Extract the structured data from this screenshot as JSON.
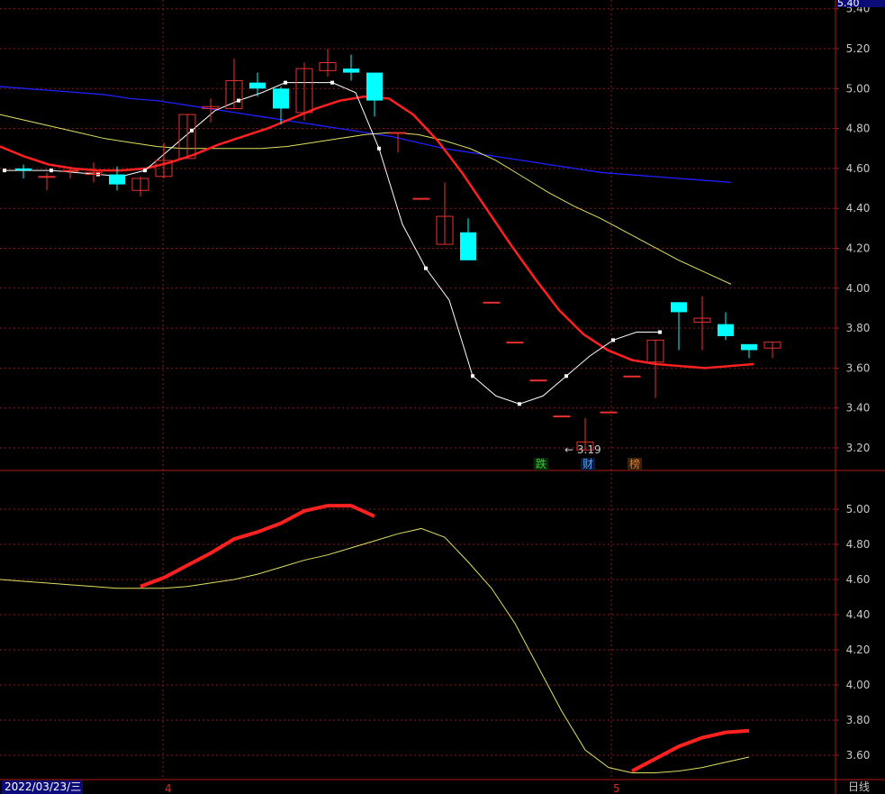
{
  "header": {
    "current_price": "5.40"
  },
  "footer": {
    "date": "2022/03/23/三",
    "period": "日线",
    "month_labels": [
      "4",
      "5"
    ]
  },
  "badges": [
    {
      "text": "跌",
      "color": "#3ec83e"
    },
    {
      "text": "财",
      "color": "#5aa0ff"
    },
    {
      "text": "榜",
      "color": "#d87a30"
    }
  ],
  "low_marker": "← 3.19",
  "colors": {
    "up": "#e83030",
    "down": "#00ffff",
    "ma_white": "#ffffff",
    "ma_red": "#ff2020",
    "ma_yellow": "#e0e060",
    "ma_blue": "#2020ff",
    "grid": "#8a1a1a",
    "border": "#b01a1a"
  },
  "chart_data": [
    {
      "type": "candlestick",
      "ylim": [
        3.05,
        5.28
      ],
      "yticks": [
        "5.40",
        "5.20",
        "5.00",
        "4.80",
        "4.60",
        "4.40",
        "4.20",
        "4.00",
        "3.80",
        "3.60",
        "3.40",
        "3.20"
      ],
      "candles": [
        {
          "o": 4.6,
          "c": 4.59,
          "h": 4.62,
          "l": 4.55
        },
        {
          "o": 4.56,
          "c": 4.56,
          "h": 4.58,
          "l": 4.49
        },
        {
          "o": 4.59,
          "c": 4.59,
          "h": 4.61,
          "l": 4.55
        },
        {
          "o": 4.57,
          "c": 4.58,
          "h": 4.63,
          "l": 4.53
        },
        {
          "o": 4.57,
          "c": 4.52,
          "h": 4.61,
          "l": 4.49
        },
        {
          "o": 4.49,
          "c": 4.55,
          "h": 4.56,
          "l": 4.46
        },
        {
          "o": 4.56,
          "c": 4.64,
          "h": 4.73,
          "l": 4.55
        },
        {
          "o": 4.65,
          "c": 4.87,
          "h": 4.87,
          "l": 4.65
        },
        {
          "o": 4.9,
          "c": 4.91,
          "h": 4.95,
          "l": 4.83
        },
        {
          "o": 4.9,
          "c": 5.04,
          "h": 5.15,
          "l": 4.9
        },
        {
          "o": 5.03,
          "c": 5.0,
          "h": 5.08,
          "l": 4.96
        },
        {
          "o": 5.0,
          "c": 4.9,
          "h": 5.01,
          "l": 4.82
        },
        {
          "o": 4.88,
          "c": 5.1,
          "h": 5.13,
          "l": 4.84
        },
        {
          "o": 5.09,
          "c": 5.13,
          "h": 5.2,
          "l": 5.06
        },
        {
          "o": 5.1,
          "c": 5.08,
          "h": 5.17,
          "l": 5.04
        },
        {
          "o": 5.08,
          "c": 4.94,
          "h": 5.08,
          "l": 4.86
        },
        {
          "o": 4.78,
          "c": 4.78,
          "h": 4.78,
          "l": 4.68
        },
        {
          "o": 4.45,
          "c": 4.45,
          "h": 4.45,
          "l": 4.45
        },
        {
          "o": 4.22,
          "c": 4.36,
          "h": 4.53,
          "l": 4.22
        },
        {
          "o": 4.28,
          "c": 4.14,
          "h": 4.35,
          "l": 4.14
        },
        {
          "o": 3.93,
          "c": 3.93,
          "h": 3.93,
          "l": 3.93
        },
        {
          "o": 3.73,
          "c": 3.73,
          "h": 3.73,
          "l": 3.73
        },
        {
          "o": 3.54,
          "c": 3.54,
          "h": 3.54,
          "l": 3.54
        },
        {
          "o": 3.36,
          "c": 3.36,
          "h": 3.36,
          "l": 3.36
        },
        {
          "o": 3.19,
          "c": 3.23,
          "h": 3.35,
          "l": 3.19
        },
        {
          "o": 3.38,
          "c": 3.38,
          "h": 3.38,
          "l": 3.38
        },
        {
          "o": 3.56,
          "c": 3.56,
          "h": 3.56,
          "l": 3.56
        },
        {
          "o": 3.63,
          "c": 3.74,
          "h": 3.74,
          "l": 3.45
        },
        {
          "o": 3.93,
          "c": 3.88,
          "h": 3.93,
          "l": 3.69
        },
        {
          "o": 3.83,
          "c": 3.85,
          "h": 3.96,
          "l": 3.69
        },
        {
          "o": 3.82,
          "c": 3.76,
          "h": 3.88,
          "l": 3.74
        },
        {
          "o": 3.72,
          "c": 3.69,
          "h": 3.72,
          "l": 3.65
        },
        {
          "o": 3.7,
          "c": 3.73,
          "h": 3.73,
          "l": 3.65
        }
      ],
      "ma_white": [
        4.59,
        4.59,
        4.59,
        4.58,
        4.57,
        4.56,
        4.59,
        4.69,
        4.79,
        4.89,
        4.94,
        4.98,
        5.03,
        5.03,
        5.03,
        4.98,
        4.7,
        4.32,
        4.1,
        3.94,
        3.56,
        3.46,
        3.42,
        3.46,
        3.56,
        3.66,
        3.74,
        3.78,
        3.78
      ],
      "ma_white_start": 0,
      "ma_red": [
        4.71,
        4.66,
        4.62,
        4.6,
        4.59,
        4.59,
        4.6,
        4.63,
        4.67,
        4.72,
        4.76,
        4.8,
        4.85,
        4.9,
        4.94,
        4.96,
        4.95,
        4.87,
        4.74,
        4.58,
        4.4,
        4.22,
        4.05,
        3.89,
        3.77,
        3.69,
        3.64,
        3.62,
        3.61,
        3.6,
        3.61,
        3.62
      ],
      "ma_red_start": 0,
      "ma_yellow": [
        4.87,
        4.84,
        4.81,
        4.78,
        4.75,
        4.73,
        4.71,
        4.7,
        4.7,
        4.7,
        4.7,
        4.71,
        4.73,
        4.75,
        4.77,
        4.78,
        4.77,
        4.74,
        4.7,
        4.64,
        4.56,
        4.48,
        4.41,
        4.35,
        4.28,
        4.21,
        4.14,
        4.08,
        4.02
      ],
      "ma_yellow_start": 0,
      "ma_blue": [
        5.01,
        5.0,
        4.99,
        4.98,
        4.97,
        4.95,
        4.94,
        4.92,
        4.9,
        4.88,
        4.86,
        4.84,
        4.82,
        4.8,
        4.78,
        4.76,
        4.73,
        4.7,
        4.68,
        4.66,
        4.64,
        4.62,
        4.6,
        4.58,
        4.57,
        4.56,
        4.55,
        4.54,
        4.53
      ],
      "ma_blue_start": 0
    },
    {
      "type": "line",
      "ylim": [
        3.5,
        5.2
      ],
      "yticks": [
        "5.00",
        "4.80",
        "4.60",
        "4.40",
        "4.20",
        "4.00",
        "3.80",
        "3.60"
      ],
      "series": [
        {
          "values": [
            4.6,
            4.59,
            4.58,
            4.57,
            4.56,
            4.55,
            4.55,
            4.55,
            4.56,
            4.58,
            4.6,
            4.63,
            4.67,
            4.71,
            4.74,
            4.78,
            4.82,
            4.86,
            4.89,
            4.84,
            4.7,
            4.55,
            4.35,
            4.1,
            3.85,
            3.63,
            3.53,
            3.5,
            3.5,
            3.51,
            3.53,
            3.56,
            3.59
          ]
        },
        {
          "values": [
            4.56,
            4.61,
            4.68,
            4.75,
            4.83,
            4.87,
            4.92,
            4.99,
            5.02,
            5.02,
            4.96
          ],
          "start": 6
        },
        {
          "values": [
            3.51,
            3.58,
            3.65,
            3.7,
            3.73,
            3.74
          ],
          "start": 27
        }
      ]
    }
  ]
}
